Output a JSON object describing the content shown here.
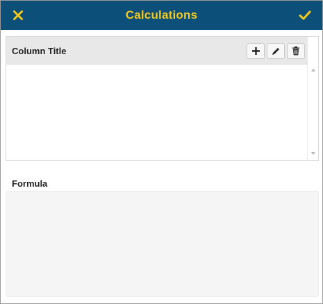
{
  "dialog": {
    "title": "Calculations",
    "close_icon": "close-icon",
    "confirm_icon": "check-icon"
  },
  "table": {
    "column_header": "Column Title",
    "actions": [
      {
        "name": "add-button",
        "icon": "plus-icon"
      },
      {
        "name": "edit-button",
        "icon": "pencil-icon"
      },
      {
        "name": "delete-button",
        "icon": "trash-icon"
      }
    ],
    "rows": []
  },
  "formula": {
    "label": "Formula",
    "value": ""
  },
  "colors": {
    "titlebar_bg": "#0c4f78",
    "title_text": "#f3c91c",
    "header_bg": "#e9e8e9",
    "formula_bg": "#f5f5f5"
  }
}
